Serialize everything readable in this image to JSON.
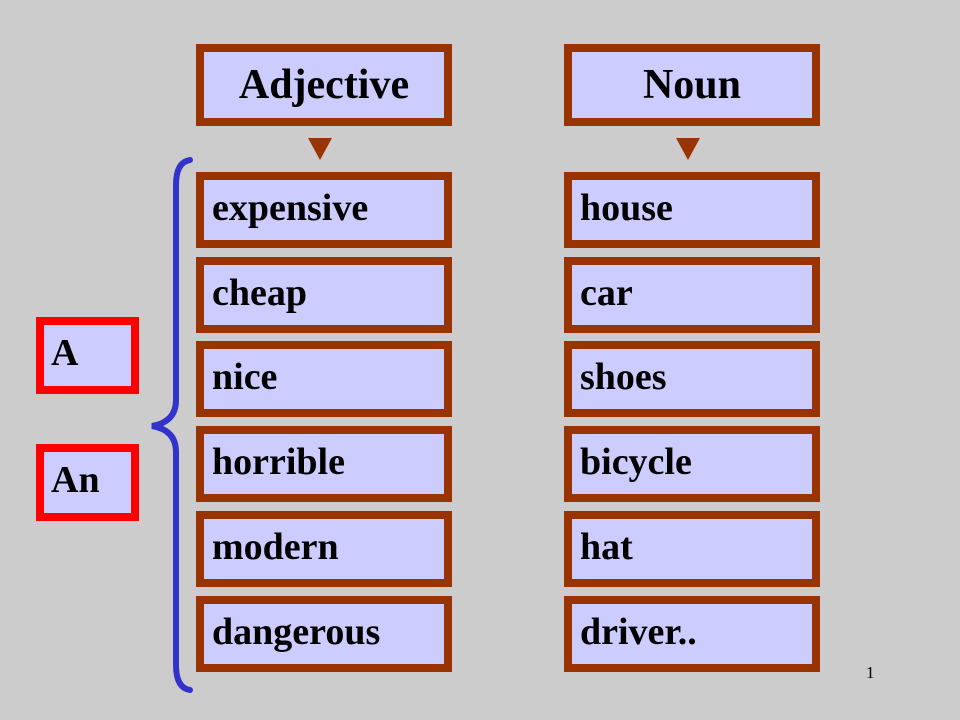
{
  "slide": {
    "page_number": "1",
    "colors": {
      "background": "#cccccc",
      "box_fill": "#ccccff",
      "box_border": "#993300",
      "article_border": "#ff0000",
      "brace": "#3333cc"
    }
  },
  "headers": {
    "adjective": "Adjective",
    "noun": "Noun"
  },
  "articles": [
    "A",
    "An"
  ],
  "adjectives": [
    "expensive",
    "cheap",
    "nice",
    "horrible",
    "modern",
    "dangerous"
  ],
  "nouns": [
    "house",
    "car",
    "shoes",
    "bicycle",
    "hat",
    "driver.."
  ]
}
